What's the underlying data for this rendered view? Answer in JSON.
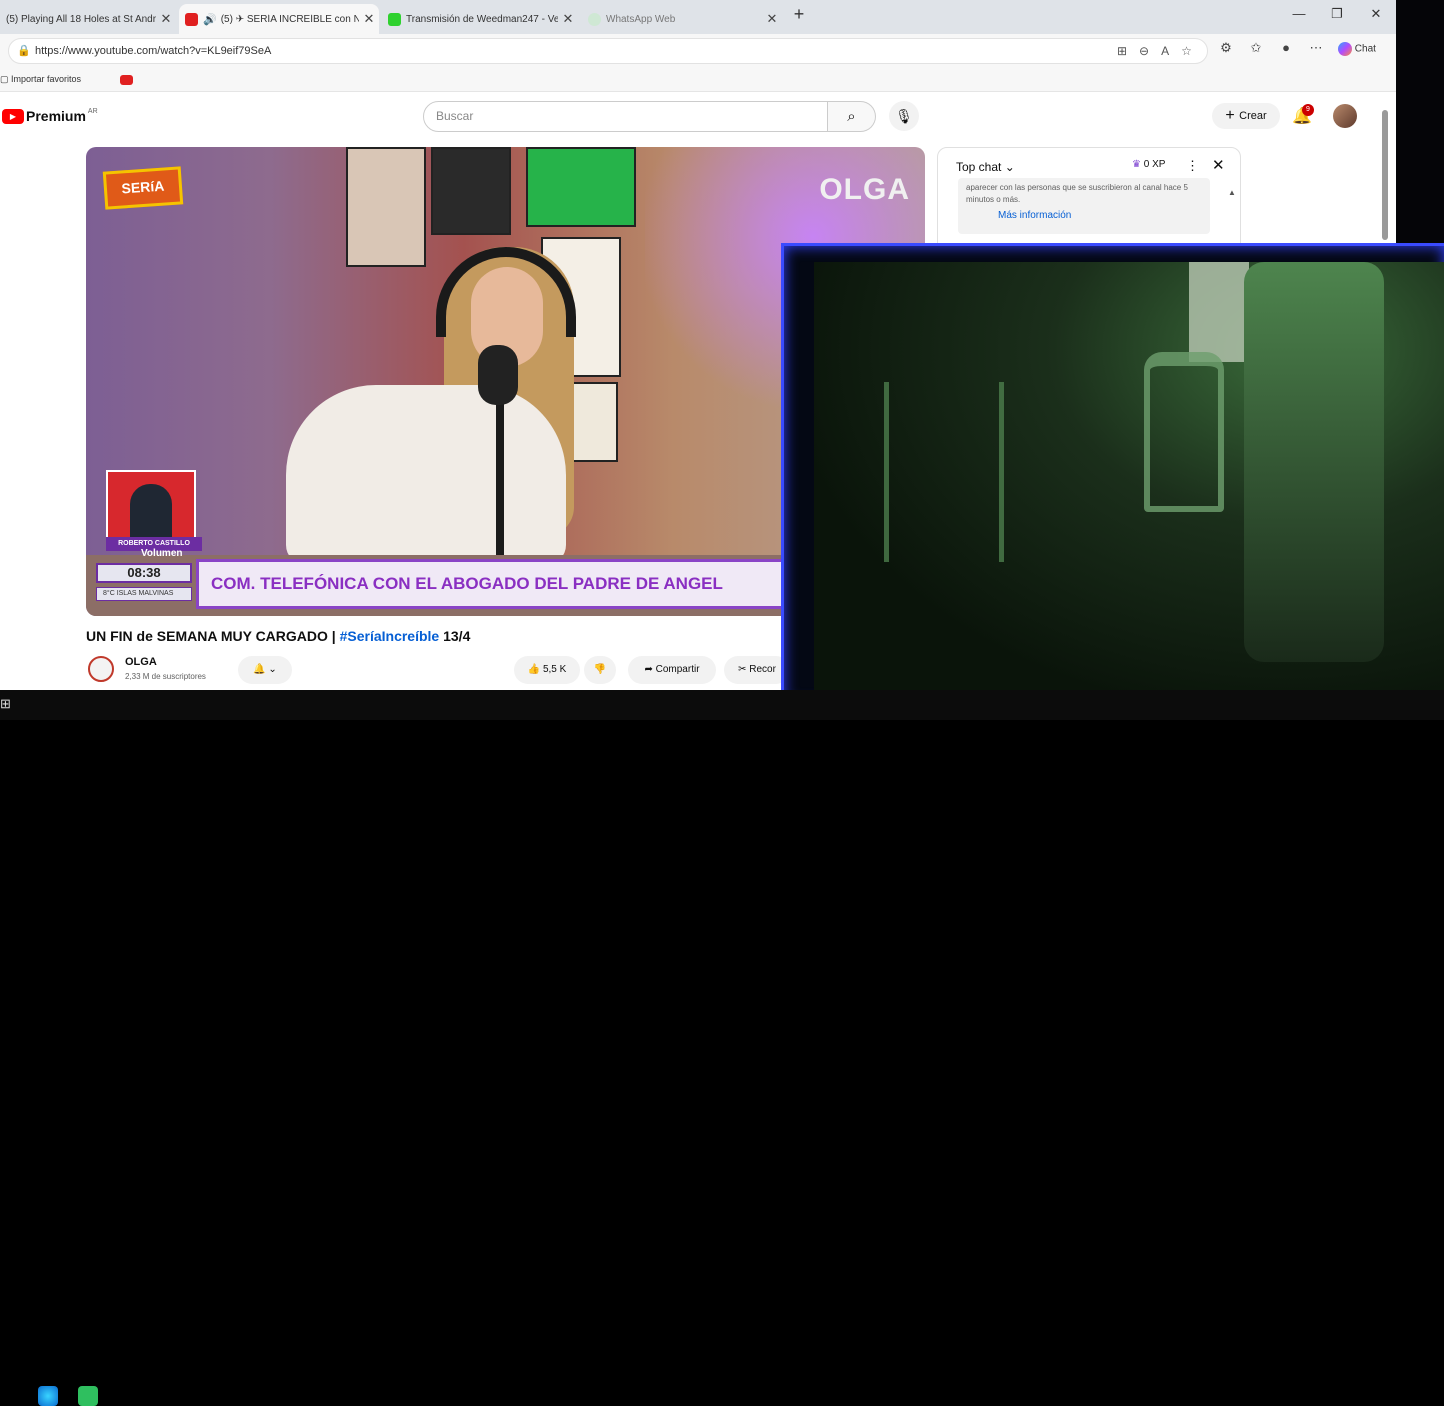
{
  "browser": {
    "tabs": [
      {
        "title": "(5) Playing All 18 Holes at St Andre",
        "active": false
      },
      {
        "title": "(5) ✈ SERÍA INCREÍBLE con N",
        "active": true
      },
      {
        "title": "Transmisión de Weedman247 - Ve",
        "active": false
      },
      {
        "title": "WhatsApp Web",
        "active": false
      }
    ],
    "new_tab": "+",
    "window_controls": {
      "minimize": "—",
      "maximize": "❐",
      "close": "✕"
    },
    "url": "https://www.youtube.com/watch?v=KL9eif79SeA",
    "chat_label": "Chat",
    "favorites_bar": {
      "import_label": "Importar favoritos"
    }
  },
  "youtube": {
    "logo_text": "Premium",
    "logo_sup": "AR",
    "search_placeholder": "Buscar",
    "create_label": "Crear",
    "notification_count": "9",
    "video": {
      "overlay_logo": "SERíA",
      "brand": "OLGA",
      "inset_name": "ROBERTO CASTILLO",
      "volume_label": "Volumen",
      "clock": "08:38",
      "temp": "8°C  ISLAS MALVINAS",
      "lower_third": "COM. TELEFÓNICA CON EL ABOGADO DEL PADRE DE ANGEL"
    },
    "title_part1": "UN FIN de SEMANA MUY CARGADO | ",
    "title_hashtag": "#SeríaIncreíble",
    "title_part2": " 13/4",
    "channel_name": "OLGA",
    "channel_subs": "2,33 M de suscriptores",
    "likes": "5,5 K",
    "share_label": "Compartir",
    "clip_label": "Recor",
    "chat": {
      "header": "Top chat",
      "xp": "0 XP",
      "notice": "aparecer con las personas que se suscribieron al canal hace 5 minutos o más.",
      "more_info": "Más información"
    }
  }
}
